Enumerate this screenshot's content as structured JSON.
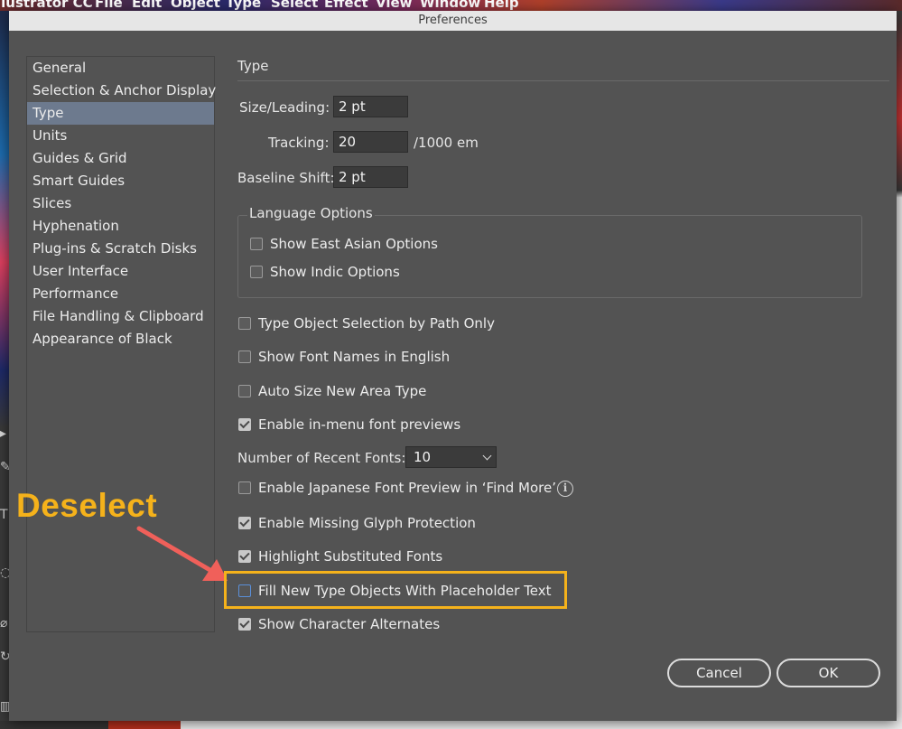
{
  "background_menu": [
    "llustrator CC",
    "File",
    "Edit",
    "Object",
    "Type",
    "Select",
    "Effect",
    "View",
    "Window",
    "Help"
  ],
  "dialog": {
    "title": "Preferences",
    "categories": [
      {
        "label": "General"
      },
      {
        "label": "Selection & Anchor Display"
      },
      {
        "label": "Type",
        "selected": true
      },
      {
        "label": "Units"
      },
      {
        "label": "Guides & Grid"
      },
      {
        "label": "Smart Guides"
      },
      {
        "label": "Slices"
      },
      {
        "label": "Hyphenation"
      },
      {
        "label": "Plug-ins & Scratch Disks"
      },
      {
        "label": "User Interface"
      },
      {
        "label": "Performance"
      },
      {
        "label": "File Handling & Clipboard"
      },
      {
        "label": "Appearance of Black"
      }
    ],
    "section_title": "Type",
    "fields": {
      "size_leading": {
        "label": "Size/Leading:",
        "value": "2 pt"
      },
      "tracking": {
        "label": "Tracking:",
        "value": "20",
        "unit": "/1000 em"
      },
      "baseline_shift": {
        "label": "Baseline Shift:",
        "value": "2 pt"
      }
    },
    "language_options": {
      "legend": "Language Options",
      "show_east_asian": {
        "label": "Show East Asian Options",
        "checked": false
      },
      "show_indic": {
        "label": "Show Indic Options",
        "checked": false
      }
    },
    "options": {
      "type_object_selection": {
        "label": "Type Object Selection by Path Only",
        "checked": false
      },
      "font_names_english": {
        "label": "Show Font Names in English",
        "checked": false
      },
      "auto_size_area_type": {
        "label": "Auto Size New Area Type",
        "checked": false
      },
      "in_menu_previews": {
        "label": "Enable in-menu font previews",
        "checked": true
      },
      "recent_fonts": {
        "label": "Number of Recent Fonts:",
        "value": "10"
      },
      "japanese_preview": {
        "label": "Enable Japanese Font Preview in ‘Find More’",
        "checked": false
      },
      "missing_glyph": {
        "label": "Enable Missing Glyph Protection",
        "checked": true
      },
      "highlight_substituted": {
        "label": "Highlight Substituted Fonts",
        "checked": true
      },
      "placeholder_text": {
        "label": "Fill New Type Objects With Placeholder Text",
        "checked": false
      },
      "character_alternates": {
        "label": "Show Character Alternates",
        "checked": true
      }
    },
    "buttons": {
      "cancel": "Cancel",
      "ok": "OK"
    }
  },
  "annotation": {
    "text": "Deselect",
    "color": "#f5b21b",
    "arrow_color": "#f0605a"
  },
  "icons": {
    "info": "info-icon",
    "dropdown": "chevron-down-icon"
  }
}
